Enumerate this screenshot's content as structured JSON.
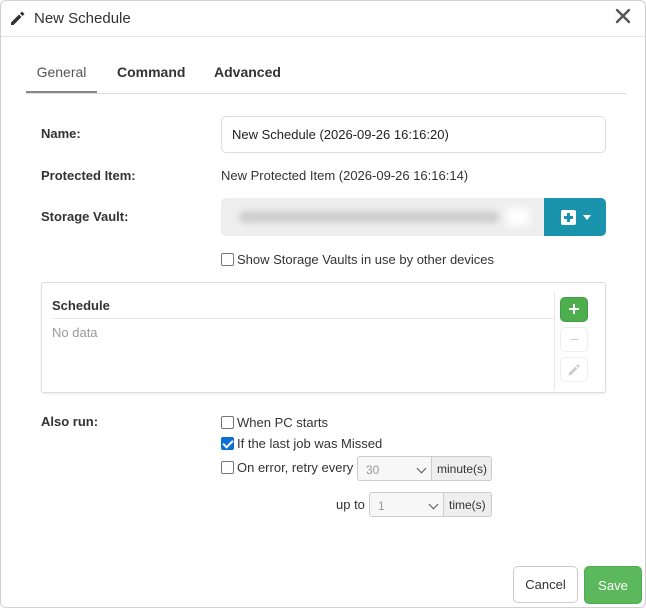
{
  "dialog": {
    "title": "New Schedule",
    "close_icon": "close-icon",
    "title_icon": "pencil-icon"
  },
  "tabs": [
    {
      "label": "General",
      "active": true
    },
    {
      "label": "Command",
      "active": false
    },
    {
      "label": "Advanced",
      "active": false
    }
  ],
  "form": {
    "name_label": "Name:",
    "name_value": "New Schedule (2026-09-26 16:16:20)",
    "protected_item_label": "Protected Item:",
    "protected_item_value": "New Protected Item (2026-09-26 16:16:14)",
    "storage_vault_label": "Storage Vault:",
    "storage_vault_button_icon": "plus-square-icon",
    "show_vaults_label": "Show Storage Vaults in use by other devices",
    "show_vaults_checked": false
  },
  "schedule": {
    "header": "Schedule",
    "empty_text": "No data",
    "add_icon": "plus-icon",
    "remove_icon": "minus-icon",
    "edit_icon": "pencil-icon"
  },
  "also_run": {
    "label": "Also run:",
    "when_pc_starts_label": "When PC starts",
    "when_pc_starts_checked": false,
    "last_job_missed_label": "If the last job was Missed",
    "last_job_missed_checked": true,
    "retry_label": "On error, retry every",
    "retry_checked": false,
    "retry_interval_value": "30",
    "retry_interval_unit": "minute(s)",
    "up_to_label": "up to",
    "retry_times_value": "1",
    "retry_times_unit": "time(s)"
  },
  "footer": {
    "cancel_label": "Cancel",
    "save_label": "Save"
  },
  "colors": {
    "accent": "#1a93ad",
    "save": "#5cb85c",
    "checkbox_checked": "#0b6fd1"
  }
}
